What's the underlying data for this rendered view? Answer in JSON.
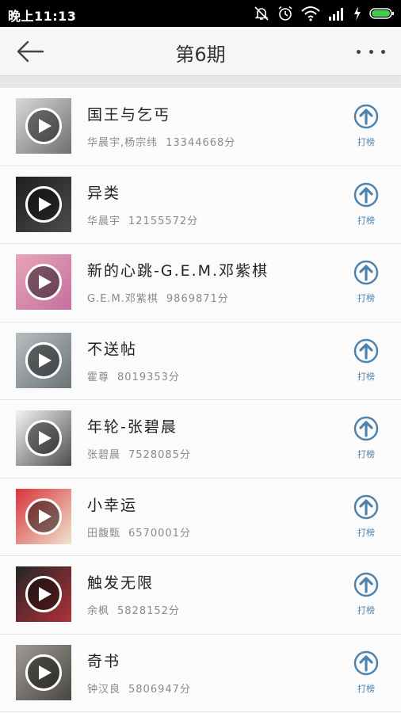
{
  "status_bar": {
    "time": "晚上11:13"
  },
  "header": {
    "title": "第6期"
  },
  "vote_label": "打榜",
  "colors": {
    "accent": "#4e83ae",
    "status_bar_bg": "#000000",
    "header_bg": "#f6f6f6"
  },
  "songs": [
    {
      "title": "国王与乞丐",
      "artist": "华晨宇,杨宗纬",
      "score": "13344668分",
      "cover_colors": [
        "#d9d9d9",
        "#6f6f6f"
      ]
    },
    {
      "title": "异类",
      "artist": "华晨宇",
      "score": "12155572分",
      "cover_colors": [
        "#1f1f1f",
        "#4c4c4c"
      ]
    },
    {
      "title": "新的心跳-G.E.M.邓紫棋",
      "artist": "G.E.M.邓紫棋",
      "score": "9869871分",
      "cover_colors": [
        "#e7a5b7",
        "#c56fa0"
      ]
    },
    {
      "title": "不送帖",
      "artist": "霍尊",
      "score": "8019353分",
      "cover_colors": [
        "#b8bdbf",
        "#6c7478"
      ]
    },
    {
      "title": "年轮-张碧晨",
      "artist": "张碧晨",
      "score": "7528085分",
      "cover_colors": [
        "#f3f3f3",
        "#4d4d4d"
      ]
    },
    {
      "title": "小幸运",
      "artist": "田馥甄",
      "score": "6570001分",
      "cover_colors": [
        "#d8343a",
        "#f0e3cf"
      ]
    },
    {
      "title": "触发无限",
      "artist": "余枫",
      "score": "5828152分",
      "cover_colors": [
        "#252525",
        "#b0323a"
      ]
    },
    {
      "title": "奇书",
      "artist": "钟汉良",
      "score": "5806947分",
      "cover_colors": [
        "#9e9a93",
        "#4a4642"
      ]
    }
  ]
}
